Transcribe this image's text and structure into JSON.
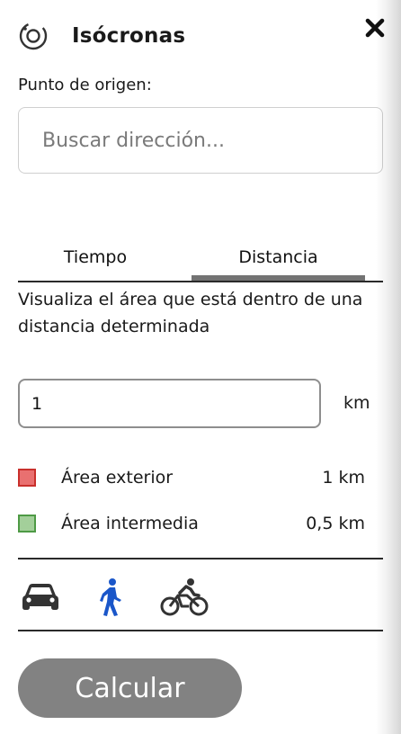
{
  "header": {
    "title": "Isócronas",
    "logo_icon": "isochrone-target-icon",
    "close_icon": "close-icon"
  },
  "origin": {
    "label": "Punto de origen:",
    "placeholder": "Buscar dirección...",
    "value": ""
  },
  "tabs": [
    {
      "label": "Tiempo",
      "active": false
    },
    {
      "label": "Distancia",
      "active": true
    }
  ],
  "description": "Visualiza el área que está dentro de una distancia determinada",
  "distance": {
    "value": "1",
    "unit": "km"
  },
  "legend": [
    {
      "label": "Área exterior",
      "value": "1 km",
      "color": "#e97070",
      "border": "#c9302c"
    },
    {
      "label": "Área intermedia",
      "value": "0,5 km",
      "color": "#a3cf9a",
      "border": "#4e9a45"
    }
  ],
  "modes": [
    {
      "icon": "car-icon",
      "active": false,
      "color": "#333333"
    },
    {
      "icon": "walk-icon",
      "active": true,
      "color": "#1a56c9"
    },
    {
      "icon": "bike-icon",
      "active": false,
      "color": "#333333"
    }
  ],
  "calculate_label": "Calcular"
}
